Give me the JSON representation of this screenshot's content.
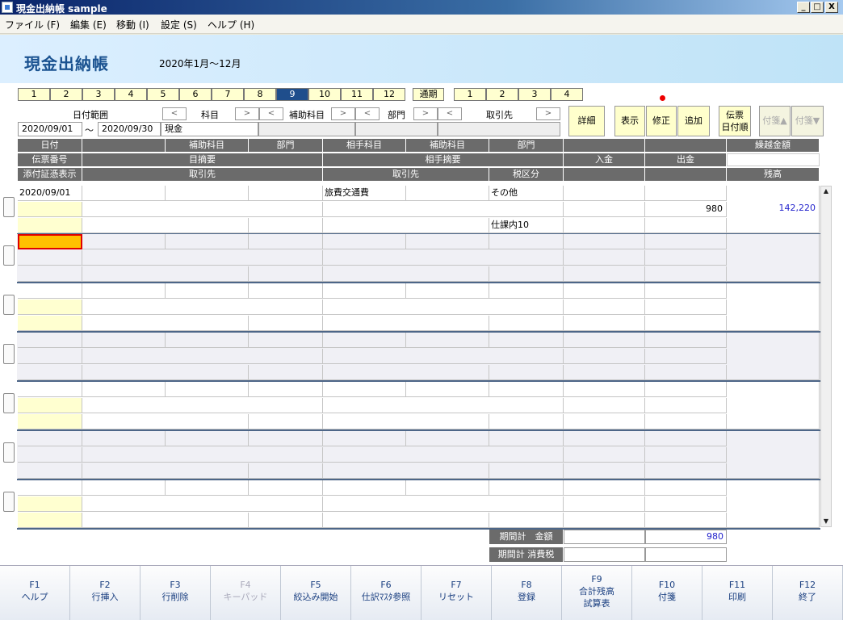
{
  "window": {
    "title": "現金出納帳 sample",
    "minimize": "_",
    "maximize": "□",
    "close": "X"
  },
  "menu": [
    "ファイル (F)",
    "編集 (E)",
    "移動 (I)",
    "設定 (S)",
    "ヘルプ (H)"
  ],
  "banner": {
    "title": "現金出納帳",
    "period": "2020年1月～12月"
  },
  "months": [
    "1",
    "2",
    "3",
    "4",
    "5",
    "6",
    "7",
    "8",
    "9",
    "10",
    "11",
    "12"
  ],
  "selected_month": "9",
  "cumulative_label": "通期",
  "quarters": [
    "1",
    "2",
    "3",
    "4"
  ],
  "filters": {
    "date_range_label": "日付範囲",
    "from": "2020/09/01",
    "tilde": "～",
    "to": "2020/09/30",
    "account_label": "科目",
    "account_value": "現金",
    "sub_account_label": "補助科目",
    "dept_label": "部門",
    "partner_label": "取引先",
    "prev": "<",
    "next": ">"
  },
  "buttons": {
    "detail": "詳細",
    "show": "表示",
    "modify": "修正",
    "add": "追加",
    "voucher1": "伝票",
    "voucher2": "日付順",
    "tag_up": "付箋▲",
    "tag_down": "付箋▼"
  },
  "headers": {
    "row1": [
      "日付",
      "",
      "補助科目",
      "部門",
      "相手科目",
      "補助科目",
      "部門",
      "",
      "",
      "繰越金額"
    ],
    "row2": [
      "伝票番号",
      "目摘要",
      "相手摘要",
      "入金",
      "出金",
      ""
    ],
    "row3": [
      "添付証憑表示",
      "取引先",
      "取引先",
      "税区分",
      "",
      "",
      "残高"
    ]
  },
  "entry": {
    "date": "2020/09/01",
    "counter_account": "旅費交通費",
    "tax": "その他",
    "tax2": "仕課内10",
    "amount_out": "980",
    "balance": "142,220"
  },
  "totals": {
    "period_amount_label": "期間計　金額",
    "period_amount": "980",
    "period_tax_label": "期間計 消費税",
    "period_tax": ""
  },
  "fkeys": [
    {
      "k": "F1",
      "l": "ヘルプ",
      "l2": ""
    },
    {
      "k": "F2",
      "l": "行挿入",
      "l2": ""
    },
    {
      "k": "F3",
      "l": "行削除",
      "l2": ""
    },
    {
      "k": "F4",
      "l": "キーパッド",
      "l2": "",
      "disabled": true
    },
    {
      "k": "F5",
      "l": "絞込み開始",
      "l2": ""
    },
    {
      "k": "F6",
      "l": "仕訳ﾏｽﾀ参照",
      "l2": ""
    },
    {
      "k": "F7",
      "l": "リセット",
      "l2": ""
    },
    {
      "k": "F8",
      "l": "登録",
      "l2": ""
    },
    {
      "k": "F9",
      "l": "合計残高",
      "l2": "試算表"
    },
    {
      "k": "F10",
      "l": "付箋",
      "l2": ""
    },
    {
      "k": "F11",
      "l": "印刷",
      "l2": ""
    },
    {
      "k": "F12",
      "l": "終了",
      "l2": ""
    }
  ],
  "colors": {
    "accent": "#1f4e8c",
    "highlight": "#ffc000",
    "note_yellow": "#ffffd0"
  }
}
